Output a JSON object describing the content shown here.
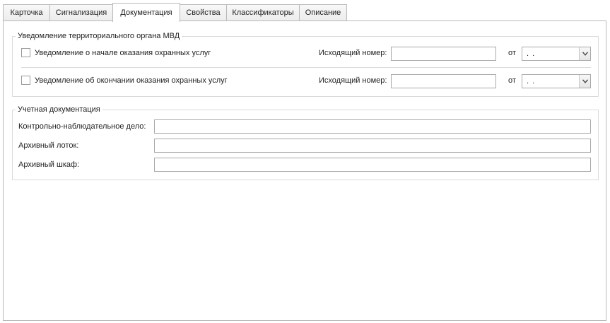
{
  "tabs": [
    {
      "label": "Карточка"
    },
    {
      "label": "Сигнализация"
    },
    {
      "label": "Документация"
    },
    {
      "label": "Свойства"
    },
    {
      "label": "Классификаторы"
    },
    {
      "label": "Описание"
    }
  ],
  "active_tab": "Документация",
  "notification_group": {
    "title": "Уведомление территориального органа МВД",
    "rows": [
      {
        "checkbox_label": "Уведомление о начале оказания охранных услуг",
        "checked": false,
        "number_label": "Исходящий номер:",
        "number_value": "",
        "date_label": "от",
        "date_value": ". ."
      },
      {
        "checkbox_label": "Уведомление об окончании оказания охранных услуг",
        "checked": false,
        "number_label": "Исходящий номер:",
        "number_value": "",
        "date_label": "от",
        "date_value": ". ."
      }
    ]
  },
  "accounting_group": {
    "title": "Учетная документация",
    "fields": [
      {
        "label": "Контрольно-наблюдательное дело:",
        "value": ""
      },
      {
        "label": "Архивный лоток:",
        "value": ""
      },
      {
        "label": "Архивный шкаф:",
        "value": ""
      }
    ]
  },
  "icons": {
    "dropdown": "chevron-down-icon"
  }
}
